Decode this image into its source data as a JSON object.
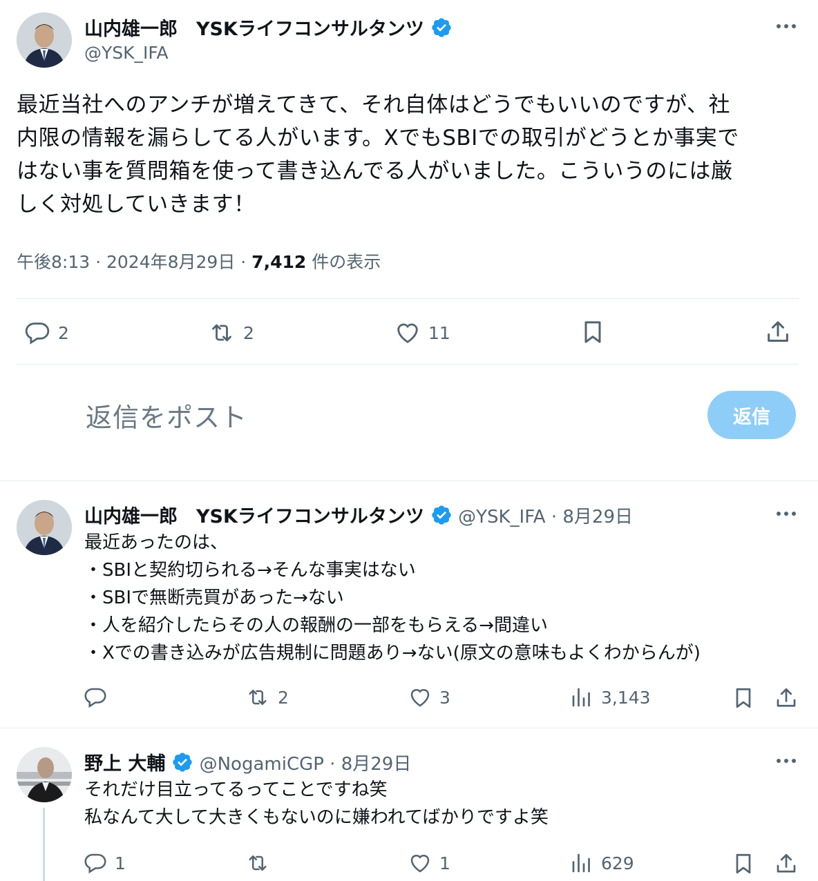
{
  "main_tweet": {
    "author_name": "山内雄一郎　YSKライフコンサルタンツ",
    "handle": "@YSK_IFA",
    "text_lines": [
      "最近当社へのアンチが増えてきて、それ自体はどうでもいいのですが、社",
      "内限の情報を漏らしてる人がいます。XでもSBIでの取引がどうとか事実で",
      "はない事を質問箱を使って書き込んでる人がいました。こういうのには厳",
      "しく対処していきます！"
    ],
    "time": "午後8:13 · 2024年8月29日 · ",
    "views_count": "7,412",
    "views_label": " 件の表示",
    "reply_count": "2",
    "retweet_count": "2",
    "like_count": "11"
  },
  "composer": {
    "placeholder": "返信をポスト",
    "button_label": "返信",
    "button_color": "#8ecdf8"
  },
  "replies": [
    {
      "author_name": "山内雄一郎　YSKライフコンサルタンツ",
      "handle_date": "@YSK_IFA · 8月29日",
      "text_lines": [
        "最近あったのは、",
        "・SBIと契約切られる→そんな事実はない",
        "・SBIで無断売買があった→ない",
        "・人を紹介したらその人の報酬の一部をもらえる→間違い",
        "・Xでの書き込みが広告規制に問題あり→ない(原文の意味もよくわからんが)"
      ],
      "reply_count": "",
      "retweet_count": "2",
      "like_count": "3",
      "views_count": "3,143"
    },
    {
      "author_name": "野上 大輔",
      "handle_date": "@NogamiCGP · 8月29日",
      "text_lines": [
        "それだけ目立ってるってことですね笑",
        "私なんて大して大きくもないのに嫌われてばかりですよ笑"
      ],
      "reply_count": "1",
      "retweet_count": "",
      "like_count": "1",
      "views_count": "629"
    }
  ],
  "colors": {
    "verified_blue": "#1d9bf0",
    "text_primary": "#0f1419",
    "text_secondary": "#536471"
  }
}
